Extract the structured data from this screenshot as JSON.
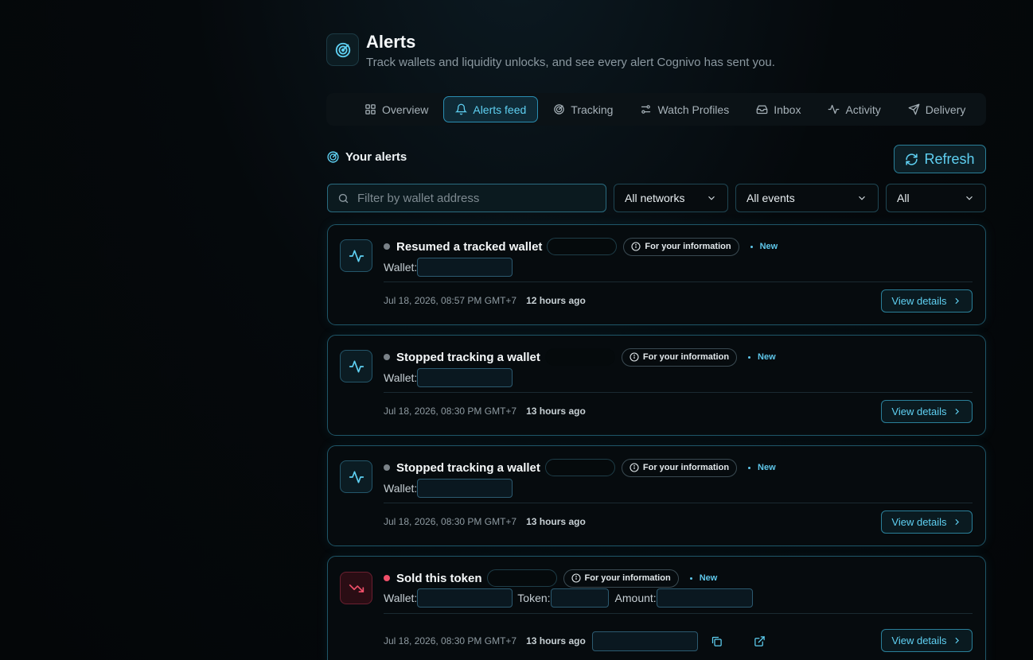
{
  "header": {
    "title": "Alerts",
    "subtitle": "Track wallets and liquidity unlocks, and see every alert Cognivo has sent you.",
    "icon": "radar-icon"
  },
  "tabs": [
    {
      "label": "Overview",
      "icon": "grid-icon",
      "active": false
    },
    {
      "label": "Alerts feed",
      "icon": "bell-icon",
      "active": true
    },
    {
      "label": "Tracking",
      "icon": "radar-icon",
      "active": false
    },
    {
      "label": "Watch Profiles",
      "icon": "sliders-icon",
      "active": false
    },
    {
      "label": "Inbox",
      "icon": "inbox-icon",
      "active": false
    },
    {
      "label": "Activity",
      "icon": "activity-icon",
      "active": false
    },
    {
      "label": "Delivery",
      "icon": "send-icon",
      "active": false
    }
  ],
  "section": {
    "title": "Your alerts",
    "refresh_label": "Refresh"
  },
  "filters": {
    "search_placeholder": "Filter by wallet address",
    "network": "All networks",
    "event": "All events",
    "status": "All"
  },
  "alerts": [
    {
      "title": "Resumed a tracked wallet",
      "severity": "grey",
      "info": "For your information",
      "new": "New",
      "wallet_label": "Wallet:",
      "timestamp": "Jul 18, 2026, 08:57 PM GMT+7",
      "ago": "12 hours ago",
      "action": "View details"
    },
    {
      "title": "Stopped tracking a wallet",
      "severity": "grey",
      "info": "For your information",
      "new": "New",
      "wallet_label": "Wallet:",
      "timestamp": "Jul 18, 2026, 08:30 PM GMT+7",
      "ago": "13 hours ago",
      "action": "View details"
    },
    {
      "title": "Stopped tracking a wallet",
      "severity": "grey",
      "info": "For your information",
      "new": "New",
      "wallet_label": "Wallet:",
      "timestamp": "Jul 18, 2026, 08:30 PM GMT+7",
      "ago": "13 hours ago",
      "action": "View details"
    },
    {
      "title": "Sold this token",
      "severity": "red",
      "info": "For your information",
      "new": "New",
      "wallet_label": "Wallet:",
      "token_label": "Token:",
      "amount_label": "Amount:",
      "timestamp": "Jul 18, 2026, 08:30 PM GMT+7",
      "ago": "13 hours ago",
      "action": "View details"
    }
  ],
  "colors": {
    "accent": "#5fd0f2",
    "card_border": "#1f5668",
    "danger": "#f0506a",
    "background": "#05090c"
  }
}
